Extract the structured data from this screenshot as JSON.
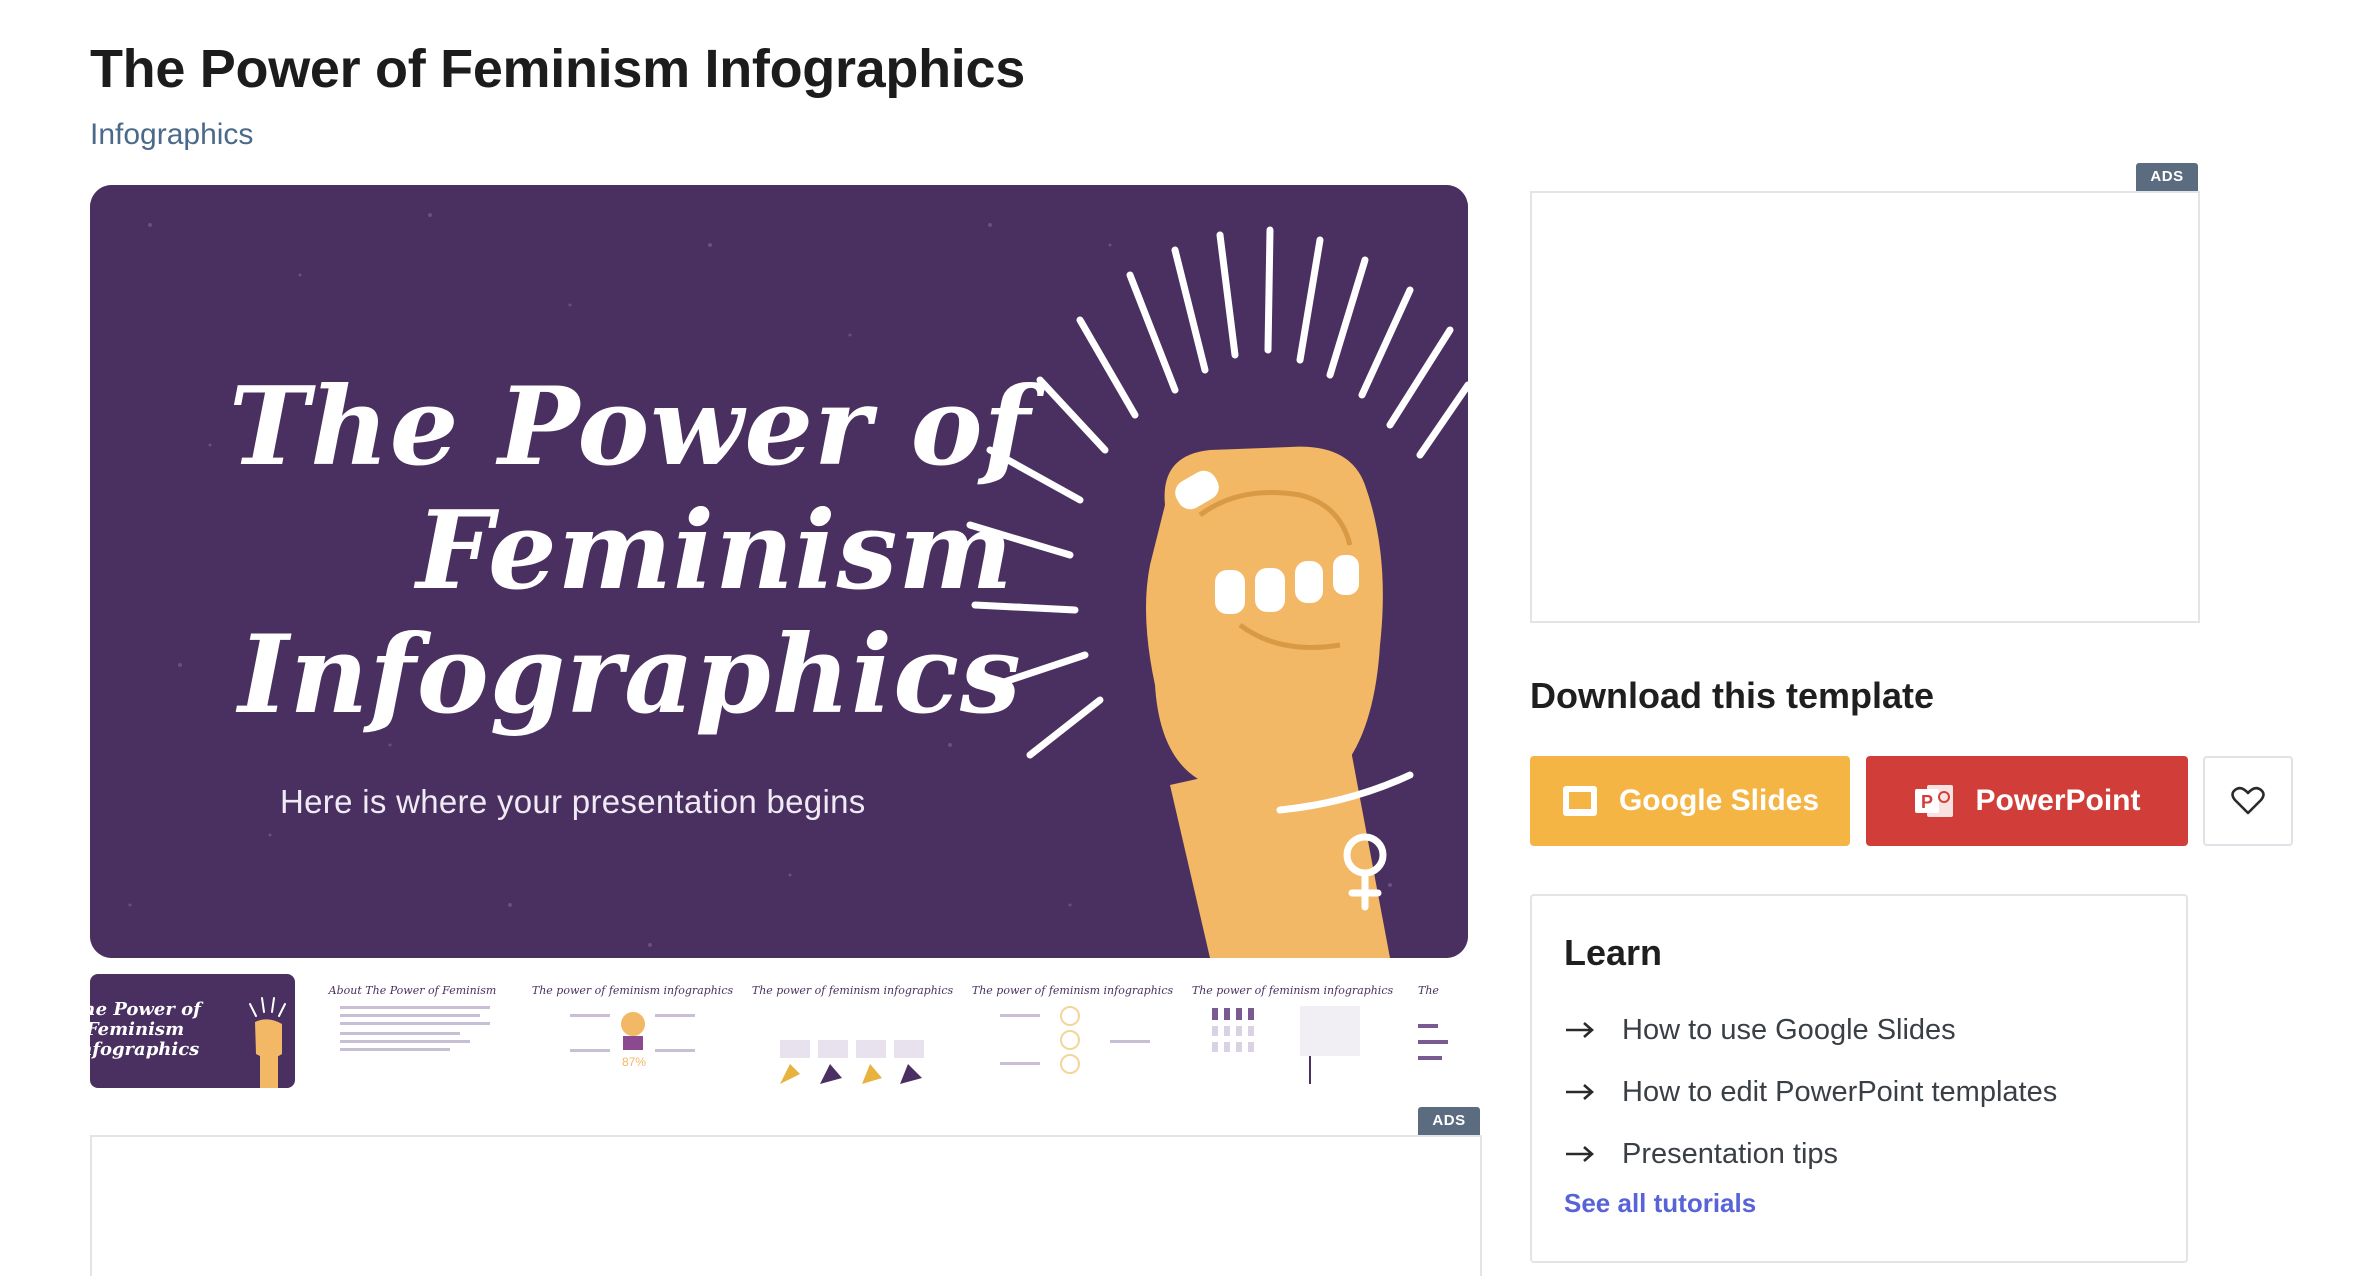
{
  "page": {
    "title": "The Power of Feminism Infographics",
    "category": "Infographics"
  },
  "hero": {
    "title_line1": "The Power of",
    "title_line2": "Feminism",
    "title_line3": "Infographics",
    "subtitle": "Here is where your presentation begins"
  },
  "thumbnails": [
    {
      "title": "The Power of Feminism Infographics"
    },
    {
      "title": "About The Power of Feminism"
    },
    {
      "title": "The power of feminism infographics"
    },
    {
      "title": "The power of feminism infographics"
    },
    {
      "title": "The power of feminism infographics"
    },
    {
      "title": "The power of feminism infographics"
    },
    {
      "title": "The"
    }
  ],
  "ads": {
    "badge": "ADS"
  },
  "download": {
    "heading": "Download this template",
    "google_slides_label": "Google Slides",
    "powerpoint_label": "PowerPoint"
  },
  "learn": {
    "heading": "Learn",
    "items": [
      {
        "label": "How to use Google Slides"
      },
      {
        "label": "How to edit PowerPoint templates"
      },
      {
        "label": "Presentation tips"
      }
    ],
    "see_all": "See all tutorials"
  },
  "colors": {
    "hero_bg": "#4a3060",
    "google_slides": "#f5b544",
    "powerpoint": "#d13e3a",
    "link": "#5763d6",
    "category": "#4b6a8a",
    "skin": "#f3b865"
  },
  "icons": [
    "google-slides-icon",
    "powerpoint-icon",
    "heart-icon",
    "arrow-right-icon",
    "female-symbol-icon"
  ]
}
